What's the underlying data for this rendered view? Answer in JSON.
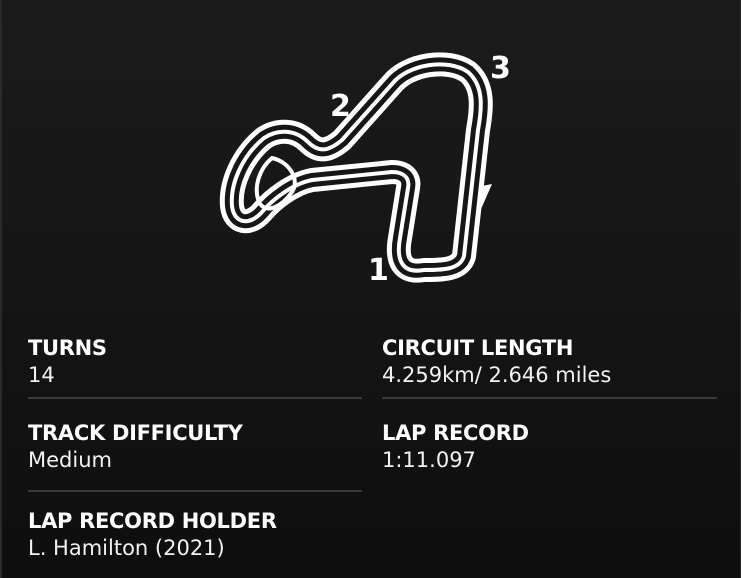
{
  "circuit": {
    "turn_markers": [
      "1",
      "2",
      "3"
    ]
  },
  "stats": {
    "turns": {
      "label": "TURNS",
      "value": "14"
    },
    "circuit_length": {
      "label": "CIRCUIT LENGTH",
      "value": "4.259km/ 2.646 miles"
    },
    "track_difficulty": {
      "label": "TRACK DIFFICULTY",
      "value": "Medium"
    },
    "lap_record": {
      "label": "LAP RECORD",
      "value": "1:11.097"
    },
    "lap_record_holder": {
      "label": "LAP RECORD HOLDER",
      "value": "L. Hamilton (2021)"
    }
  },
  "colors": {
    "background": "#161616",
    "text": "#ffffff",
    "divider": "#3a3a3a",
    "track": "#ffffff"
  }
}
